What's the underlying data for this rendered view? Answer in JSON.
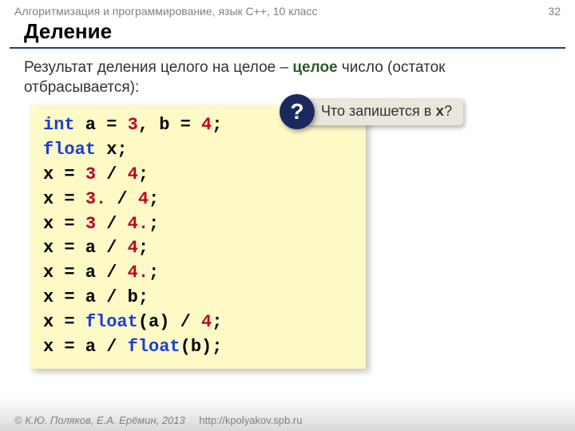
{
  "header": {
    "breadcrumb": "Алгоритмизация и программирование, язык  C++, 10 класс",
    "page_number": "32"
  },
  "title": "Деление",
  "subtitle": {
    "before": "Результат деления целого на целое – ",
    "em": "целое",
    "after": " число (остаток отбрасывается):"
  },
  "code": {
    "l1_kw": "int",
    "l1_a": " a = ",
    "l1_n1": "3",
    "l1_mid": ", b = ",
    "l1_n2": "4",
    "l1_end": ";",
    "l2_kw": "float",
    "l2_rest": " x;",
    "l3_a": "x = ",
    "l3_n1": "3",
    "l3_op": " / ",
    "l3_n2": "4",
    "l3_end": ";",
    "l4_a": "x = ",
    "l4_n1": "3.",
    "l4_op": " / ",
    "l4_n2": "4",
    "l4_end": ";",
    "l5_a": "x = ",
    "l5_n1": "3",
    "l5_op": " / ",
    "l5_n2": "4.",
    "l5_end": ";",
    "l6_a": "x = a / ",
    "l6_n": "4",
    "l6_end": ";",
    "l7_a": "x = a / ",
    "l7_n": "4.",
    "l7_end": ";",
    "l8": "x = a / b;",
    "l9_a": "x = ",
    "l9_kw": "float",
    "l9_mid": "(a) / ",
    "l9_n": "4",
    "l9_end": ";",
    "l10_a": "x = a / ",
    "l10_kw": "float",
    "l10_end": "(b);"
  },
  "callout": {
    "mark": "?",
    "text_before": "Что запишется в ",
    "var": "x",
    "text_after": "?"
  },
  "footer": {
    "copyright": "© К.Ю. Поляков, Е.А. Ерёмин, 2013",
    "url": "http://kpolyakov.spb.ru"
  }
}
